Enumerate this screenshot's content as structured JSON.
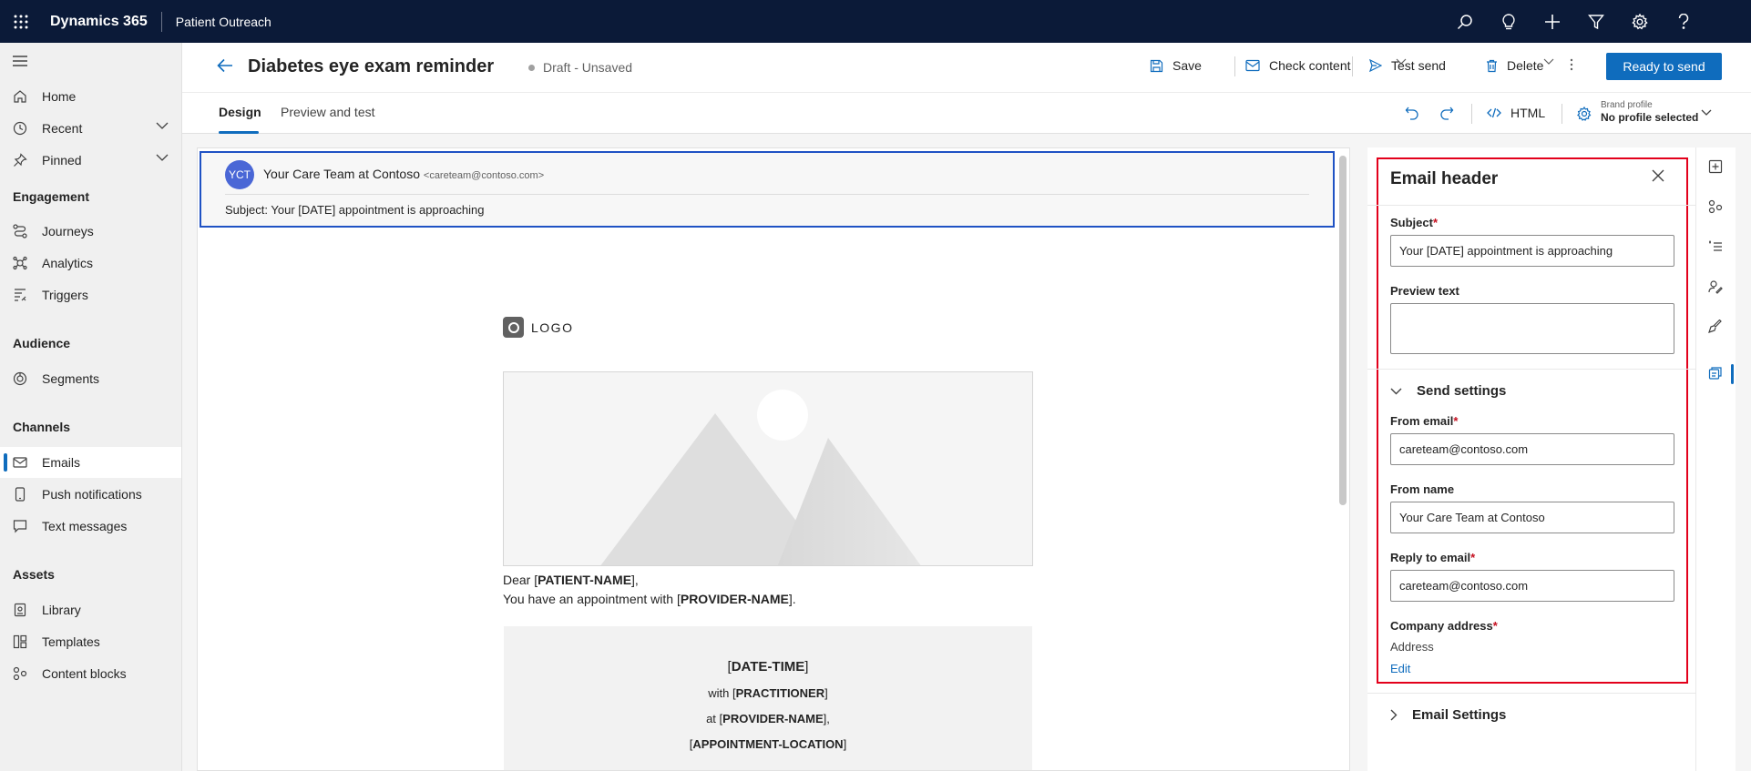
{
  "topbar": {
    "app_name": "Dynamics 365",
    "area_name": "Patient Outreach",
    "icons": [
      "search-icon",
      "lightbulb-icon",
      "plus-icon",
      "filter-icon",
      "gear-icon",
      "help-icon"
    ]
  },
  "nav": {
    "items": [
      {
        "label": "Home",
        "icon": "home-icon"
      },
      {
        "label": "Recent",
        "icon": "clock-icon"
      },
      {
        "label": "Pinned",
        "icon": "pin-icon"
      }
    ],
    "sections": [
      {
        "header": "Engagement",
        "items": [
          "Journeys",
          "Analytics",
          "Triggers"
        ]
      },
      {
        "header": "Audience",
        "items": [
          "Segments"
        ]
      },
      {
        "header": "Channels",
        "items": [
          "Emails",
          "Push notifications",
          "Text messages"
        ]
      },
      {
        "header": "Assets",
        "items": [
          "Library",
          "Templates",
          "Content blocks"
        ]
      }
    ]
  },
  "header": {
    "title": "Diabetes eye exam reminder",
    "status": "Draft - Unsaved",
    "save": "Save",
    "check_content": "Check content",
    "test_send": "Test send",
    "delete": "Delete",
    "ready": "Ready to send"
  },
  "tabs": {
    "design": "Design",
    "preview": "Preview and test",
    "html": "HTML",
    "brand_small": "Brand profile",
    "brand_big": "No profile selected"
  },
  "email": {
    "avatar": "YCT",
    "sender_name": "Your Care Team at Contoso",
    "sender_email": "<careteam@contoso.com>",
    "subject_label": "Subject:",
    "subject_value": "Your [DATE] appointment is approaching",
    "logo_text": "LOGO",
    "dear_prefix": "Dear [",
    "patient_name": "PATIENT-NAME",
    "dear_suffix": "],",
    "appt_prefix": "You have an appointment with [",
    "provider_name": "PROVIDER-NAME",
    "appt_suffix": "].",
    "card": {
      "date_time": "DATE-TIME",
      "with_prefix": "with [",
      "practitioner": "PRACTITIONER",
      "at_prefix": "at [",
      "provider": "PROVIDER-NAME",
      "location": "APPOINTMENT-LOCATION"
    }
  },
  "panel": {
    "title": "Email header",
    "subject_label": "Subject",
    "subject_value": "Your [DATE] appointment is approaching",
    "preview_label": "Preview text",
    "preview_value": "",
    "send_settings": "Send settings",
    "from_email_label": "From email",
    "from_email_value": "careteam@contoso.com",
    "from_name_label": "From name",
    "from_name_value": "Your Care Team at Contoso",
    "reply_label": "Reply to email",
    "reply_value": "careteam@contoso.com",
    "company_label": "Company address",
    "address": "Address",
    "edit": "Edit",
    "email_settings": "Email Settings",
    "required_mark": "*"
  },
  "colors": {
    "accent": "#0f6cbd",
    "topbar": "#0b1a38",
    "highlight": "#e3001b"
  }
}
